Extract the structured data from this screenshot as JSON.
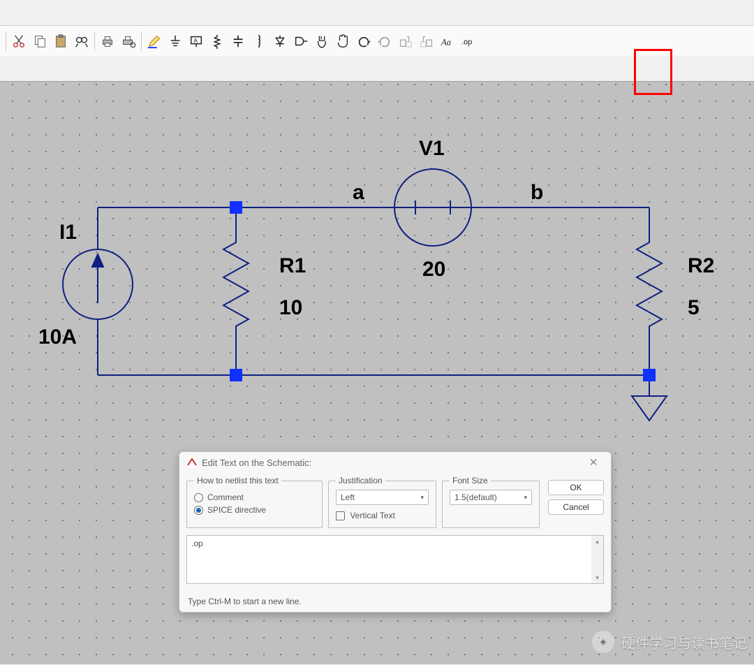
{
  "toolbar": {
    "buttons": [
      "cut-icon",
      "copy-icon",
      "paste-icon",
      "find-icon",
      "|",
      "print-icon",
      "print-setup-icon",
      "|",
      "pencil-icon",
      "ground-icon",
      "label-icon",
      "resistor-icon",
      "capacitor-icon",
      "inductor-icon",
      "diode-icon",
      "component-icon",
      "move-icon",
      "drag-icon",
      "undo-icon",
      "redo-icon",
      "rotate-left-icon",
      "rotate-right-icon",
      "text-style-icon",
      "spice-directive-icon"
    ],
    "highlighted": "spice-directive-icon"
  },
  "schematic": {
    "components": {
      "I1": {
        "name": "I1",
        "value": "10A"
      },
      "R1": {
        "name": "R1",
        "value": "10"
      },
      "V1": {
        "name": "V1",
        "value": "20"
      },
      "R2": {
        "name": "R2",
        "value": "5"
      }
    },
    "nets": {
      "a": "a",
      "b": "b"
    }
  },
  "dialog": {
    "title": "Edit Text on the Schematic:",
    "netlist_group": "How to netlist this text",
    "opt_comment": "Comment",
    "opt_directive": "SPICE directive",
    "selected_option": "directive",
    "justification_group": "Justification",
    "justification_value": "Left",
    "vertical_text_label": "Vertical Text",
    "vertical_text_checked": false,
    "fontsize_group": "Font Size",
    "fontsize_value": "1.5(default)",
    "ok": "OK",
    "cancel": "Cancel",
    "textarea": ".op",
    "status": "Type Ctrl-M to start a new line."
  },
  "watermark": "硬件学习与读书笔记"
}
